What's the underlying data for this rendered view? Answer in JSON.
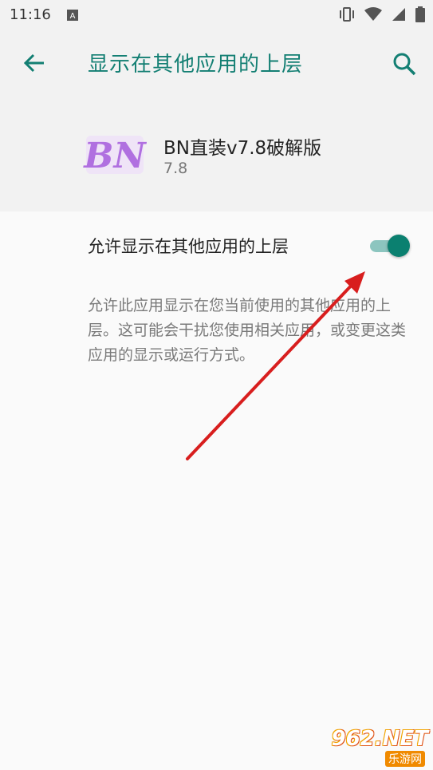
{
  "status_bar": {
    "time": "11:16",
    "icons": [
      "notification-a-icon",
      "vibrate-icon",
      "wifi-icon",
      "signal-icon",
      "battery-icon"
    ]
  },
  "app_bar": {
    "title": "显示在其他应用的上层",
    "back_icon": "back-arrow-icon",
    "search_icon": "search-icon",
    "accent_color": "#137f73"
  },
  "app_info": {
    "icon_text": "BN",
    "name": "BN直装v7.8破解版",
    "version": "7.8"
  },
  "permission": {
    "label": "允许显示在其他应用的上层",
    "enabled": true,
    "description": "允许此应用显示在您当前使用的其他应用的上层。这可能会干扰您使用相关应用，或变更这类应用的显示或运行方式。"
  },
  "watermark": {
    "logo": "962.NET",
    "sub": "乐游网"
  },
  "colors": {
    "switch_thumb": "#0b8070",
    "switch_track": "#8cc5bf",
    "annotation_arrow": "#d81e1e"
  }
}
